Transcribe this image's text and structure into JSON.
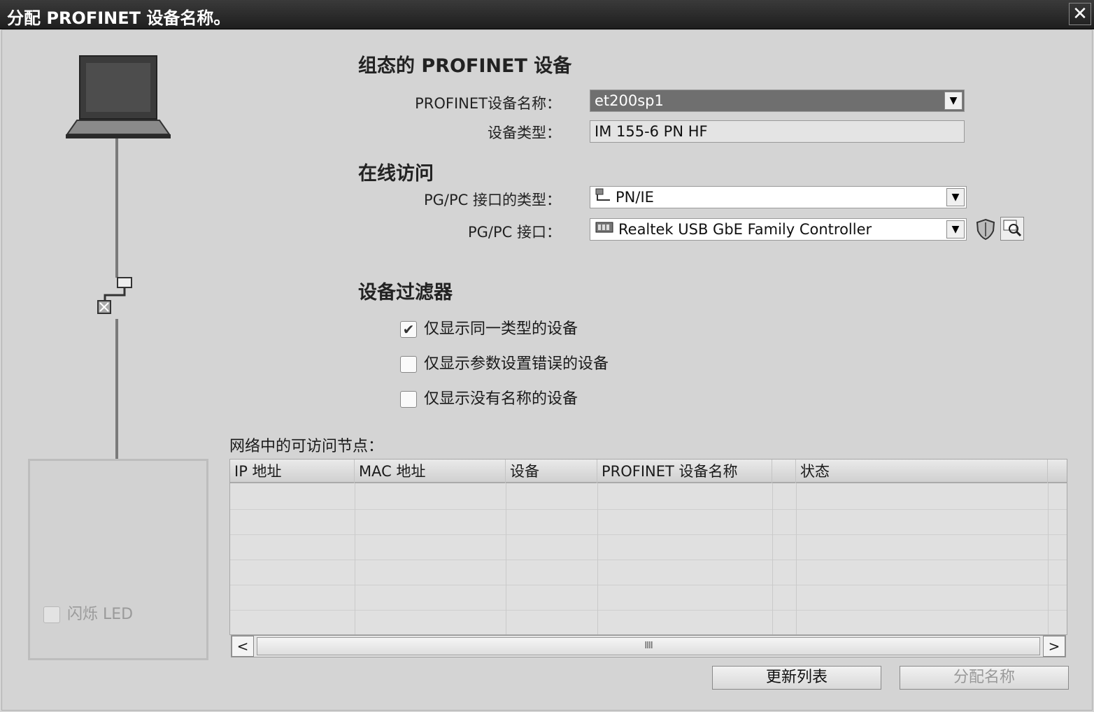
{
  "window": {
    "title": "分配 PROFINET 设备名称。",
    "close_glyph": "✕"
  },
  "configured": {
    "heading": "组态的 PROFINET 设备",
    "name_label": "PROFINET设备名称：",
    "name_value": "et200sp1",
    "type_label": "设备类型：",
    "type_value": "IM 155-6 PN HF"
  },
  "online": {
    "heading": "在线访问",
    "iface_type_label": "PG/PC 接口的类型：",
    "iface_type_value": "PN/IE",
    "iface_label": "PG/PC 接口：",
    "iface_value": "Realtek USB GbE Family Controller"
  },
  "filter": {
    "heading": "设备过滤器",
    "options": [
      {
        "label": "仅显示同一类型的设备",
        "checked": true
      },
      {
        "label": "仅显示参数设置错误的设备",
        "checked": false
      },
      {
        "label": "仅显示没有名称的设备",
        "checked": false
      }
    ]
  },
  "nodes": {
    "caption": "网络中的可访问节点：",
    "columns": [
      "IP 地址",
      "MAC 地址",
      "设备",
      "PROFINET 设备名称",
      "状态"
    ],
    "rows": []
  },
  "led": {
    "label": "闪烁 LED",
    "checked": false,
    "enabled": false
  },
  "buttons": {
    "refresh": "更新列表",
    "assign": "分配名称"
  },
  "icons": {
    "dropdown": "chevron-down-icon",
    "pnie": "network-port-icon",
    "adapter": "network-adapter-icon",
    "shield": "shield-icon",
    "search": "search-device-icon"
  },
  "check_glyph": "✔",
  "ellipsis": "...",
  "scroll": {
    "left": "<",
    "right": ">",
    "grip": "IIII"
  }
}
